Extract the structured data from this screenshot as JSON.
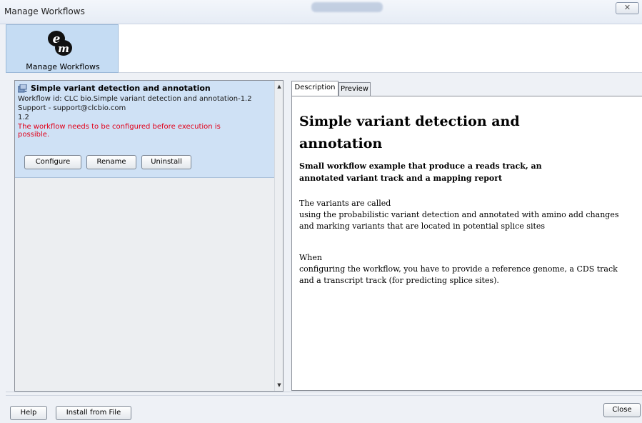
{
  "window": {
    "title": "Manage Workflows",
    "close_glyph": "✕"
  },
  "toolbar": {
    "manage_workflows_label": "Manage Workflows",
    "logo_icon": "workflow-manager-logo"
  },
  "workflow": {
    "name": "Simple variant detection and annotation",
    "id_line": "Workflow id: CLC bio.Simple variant detection and annotation-1.2",
    "support_line": "Support - support@clcbio.com",
    "version": "1.2",
    "warning": "The workflow needs to be configured before execution is possible.",
    "buttons": {
      "configure": "Configure",
      "rename": "Rename",
      "uninstall": "Uninstall"
    }
  },
  "tabs": {
    "description": "Description",
    "preview": "Preview"
  },
  "description": {
    "heading_line1": "Simple variant detection and",
    "heading_line2": "annotation",
    "subheading_line1": "Small workflow example that produce a reads track, an",
    "subheading_line2": "annotated variant track and a mapping report",
    "para1_line1": "The variants are called",
    "para1_line2": "using the probabilistic variant detection and annotated with amino add changes",
    "para1_line3": "and marking variants that are located in potential splice sites",
    "para2_line1": "When",
    "para2_line2": "configuring the workflow, you have to provide a reference genome, a CDS track",
    "para2_line3": "and a transcript track (for predicting splice sites)."
  },
  "bottom": {
    "help": "Help",
    "install_from_file": "Install from File",
    "close": "Close"
  },
  "colors": {
    "selection": "#cfe1f5",
    "warning": "#e2001a",
    "toolbar_selected": "#c5dcf3"
  }
}
